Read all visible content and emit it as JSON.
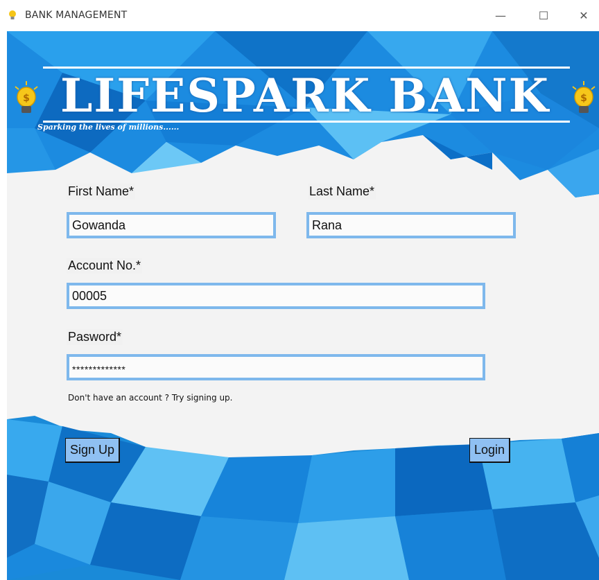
{
  "window": {
    "title": "BANK MANAGEMENT",
    "minimize_glyph": "—",
    "maximize_glyph": "☐",
    "close_glyph": "✕"
  },
  "brand": {
    "name": "LIFESPARK BANK",
    "tagline": "Sparking the lives of millions......",
    "icon": "lightbulb-dollar-icon"
  },
  "form": {
    "first_name": {
      "label": "First Name*",
      "value": "Gowanda"
    },
    "last_name": {
      "label": "Last Name*",
      "value": "Rana"
    },
    "account_no": {
      "label": "Account No.*",
      "value": "00005"
    },
    "password": {
      "label": "Pasword*",
      "value": "*************"
    },
    "hint": "Don't have an account ? Try signing up."
  },
  "buttons": {
    "signup": "Sign Up",
    "login": "Login"
  },
  "colors": {
    "accent": "#7eb8ec",
    "button": "#8fc0f2",
    "background_blue": "#1a8ad8"
  }
}
